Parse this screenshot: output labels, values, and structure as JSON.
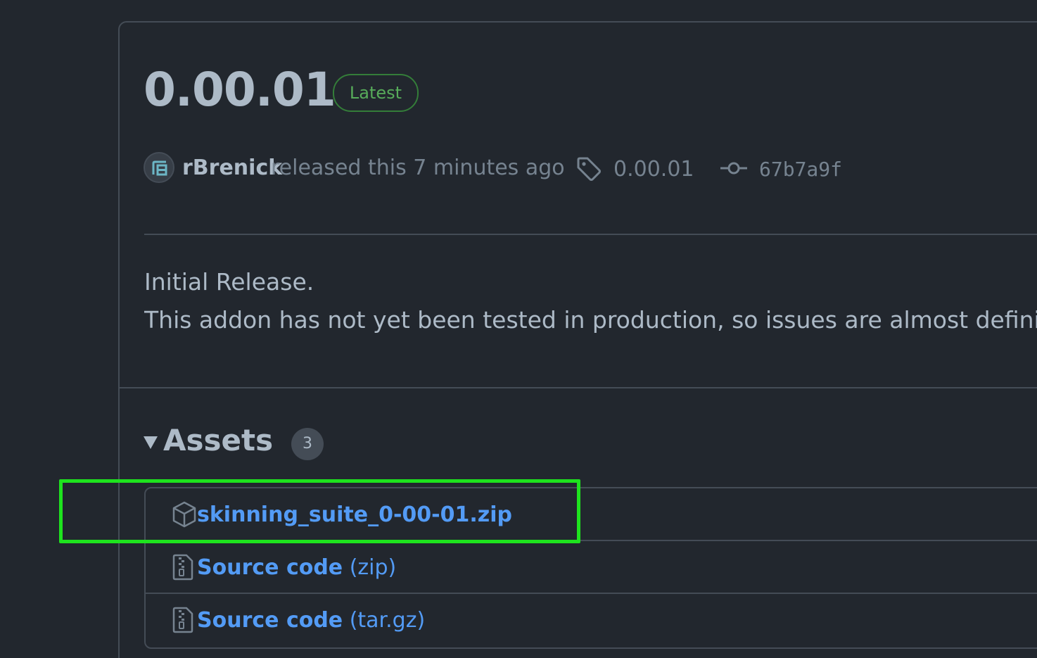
{
  "release": {
    "title": "0.00.01",
    "badge": "Latest",
    "author": "rBrenick",
    "released_text": "released this 7 minutes ago",
    "tag": "0.00.01",
    "commit": "67b7a9f"
  },
  "notes": {
    "line1": "Initial Release.",
    "line2": "This addon has not yet been tested in production, so issues are almost definitely"
  },
  "assets": {
    "title": "Assets",
    "count": "3",
    "items": [
      {
        "name": "skinning_suite_0-00-01.zip",
        "suffix": "",
        "icon": "package-icon"
      },
      {
        "name": "Source code",
        "suffix": " (zip)",
        "icon": "file-zip-icon"
      },
      {
        "name": "Source code",
        "suffix": " (tar.gz)",
        "icon": "file-zip-icon"
      }
    ]
  },
  "colors": {
    "background": "#22272e",
    "border": "#444c56",
    "link": "#539bf5",
    "latest": "#57ab5a",
    "highlight": "#1ee31e"
  }
}
